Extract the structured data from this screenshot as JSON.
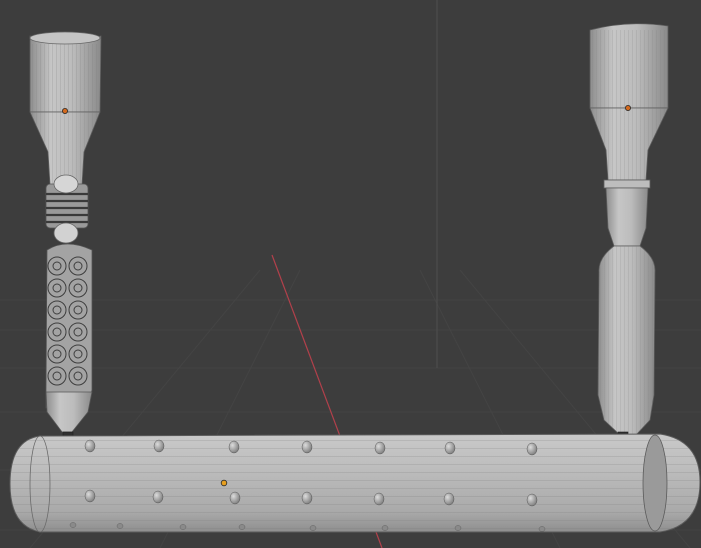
{
  "viewport": {
    "background": "#3d3d3d",
    "grid_color": "#444444",
    "x_axis_color": "#b1404b",
    "z_axis_color": "#4a4a4a"
  },
  "objects": [
    {
      "name": "handle-left",
      "style": "knurled-grip"
    },
    {
      "name": "handle-right",
      "style": "smooth-grip"
    },
    {
      "name": "roller-body",
      "style": "studded-cylinder"
    }
  ],
  "origin_markers": {
    "color": "#d2691e",
    "selected_color": "#e8a020"
  },
  "mesh": {
    "surface_color": "#b8b8b8",
    "wire_color": "#6a6a6a"
  }
}
